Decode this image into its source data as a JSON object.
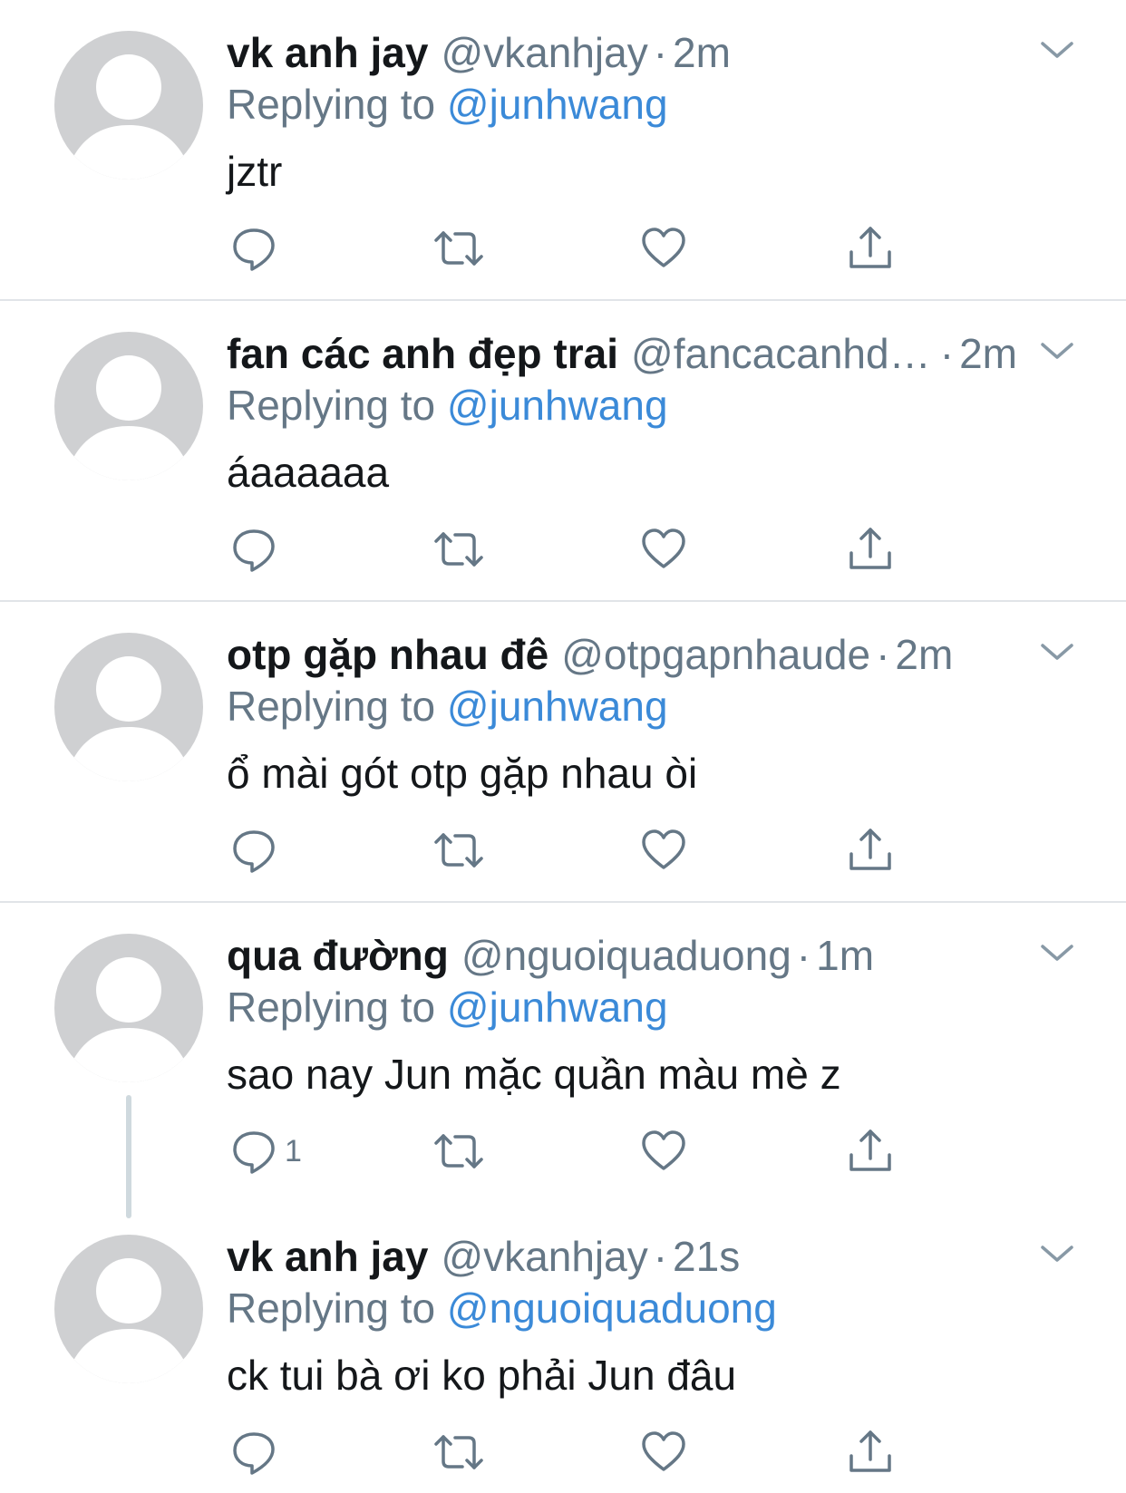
{
  "colors": {
    "text": "#14171a",
    "secondary": "#657786",
    "mention": "#3b8ad8",
    "divider": "#e1e4e8",
    "avatar_bg": "#cfd0d2"
  },
  "tweets": [
    {
      "name": "vk anh jay",
      "handle": "@vkanhjay",
      "dot": "·",
      "time": "2m",
      "reply_prefix": "Replying to",
      "reply_mention": "@junhwang",
      "text": "jztr",
      "reply_count": ""
    },
    {
      "name": "fan các anh đẹp trai",
      "handle": "@fancacanhdeptrai",
      "dot": "·",
      "time": "2m",
      "reply_prefix": "Replying to",
      "reply_mention": "@junhwang",
      "text": "áaaaaaa",
      "reply_count": ""
    },
    {
      "name": "otp gặp nhau đê",
      "handle": "@otpgapnhaude",
      "dot": "·",
      "time": "2m",
      "reply_prefix": "Replying to",
      "reply_mention": "@junhwang",
      "text": "ổ mài gót otp gặp nhau òi",
      "reply_count": ""
    },
    {
      "name": "qua đường",
      "handle": "@nguoiquaduong",
      "dot": "·",
      "time": "1m",
      "reply_prefix": "Replying to",
      "reply_mention": "@junhwang",
      "text": "sao nay Jun mặc quần màu mè z",
      "reply_count": "1"
    },
    {
      "name": "vk anh jay",
      "handle": "@vkanhjay",
      "dot": "·",
      "time": "21s",
      "reply_prefix": "Replying to",
      "reply_mention": "@nguoiquaduong",
      "text": "ck tui bà ơi ko phải Jun đâu",
      "reply_count": ""
    }
  ],
  "icons": {
    "avatar": "default-avatar-icon",
    "menu": "chevron-down-icon",
    "reply": "reply-icon",
    "retweet": "retweet-icon",
    "like": "heart-icon",
    "share": "share-icon"
  }
}
